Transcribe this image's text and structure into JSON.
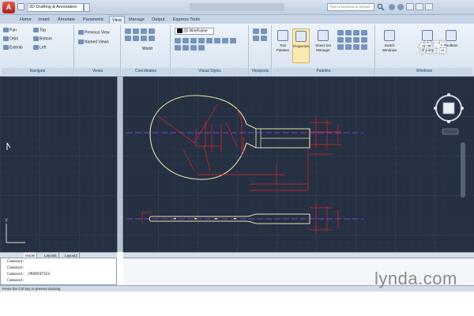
{
  "titlebar": {
    "app_menu_label": "A",
    "workspace": "2D Drafting & Annotation",
    "search_placeholder": "Type a keyword or phrase"
  },
  "tabs": [
    {
      "label": "Home"
    },
    {
      "label": "Insert"
    },
    {
      "label": "Annotate"
    },
    {
      "label": "Parametric"
    },
    {
      "label": "View"
    },
    {
      "label": "Manage"
    },
    {
      "label": "Output"
    },
    {
      "label": "Express Tools"
    }
  ],
  "active_tab": "View",
  "ribbon": {
    "navigate": {
      "title": "Navigate",
      "pan": "Pan",
      "orbit": "Orbit",
      "extents": "Extents",
      "top": "Top",
      "bottom": "Bottom",
      "left": "Left"
    },
    "views": {
      "title": "Views",
      "previous_view": "Previous View",
      "named_views": "Named Views"
    },
    "coordinates": {
      "title": "Coordinates",
      "world": "World"
    },
    "visual_styles": {
      "title": "Visual Styles",
      "current": "2D Wireframe"
    },
    "viewports": {
      "title": "Viewports"
    },
    "palettes": {
      "title": "Palettes",
      "tool_palettes": "Tool Palettes",
      "properties": "Properties",
      "sheet_set_manager": "Sheet Set Manager"
    },
    "windows": {
      "title": "Windows",
      "switch_windows": "Switch Windows",
      "user_interface": "User Interface",
      "toolbars": "Toolbars"
    }
  },
  "layout_tabs": [
    "Model",
    "Layout1",
    "Layout2"
  ],
  "command_lines": [
    "Command:",
    "Command:",
    "Command: _PROPERTIES",
    "Command:"
  ],
  "status_text": "Press the Ctrl key to prevent docking",
  "watermarks": {
    "youku": "优酷",
    "lynda": "lynda.com"
  },
  "colors": {
    "canvas": "#253042",
    "outline": "#e8e2a8",
    "dimension": "#e0262b",
    "centerline": "#7a3fd6"
  }
}
